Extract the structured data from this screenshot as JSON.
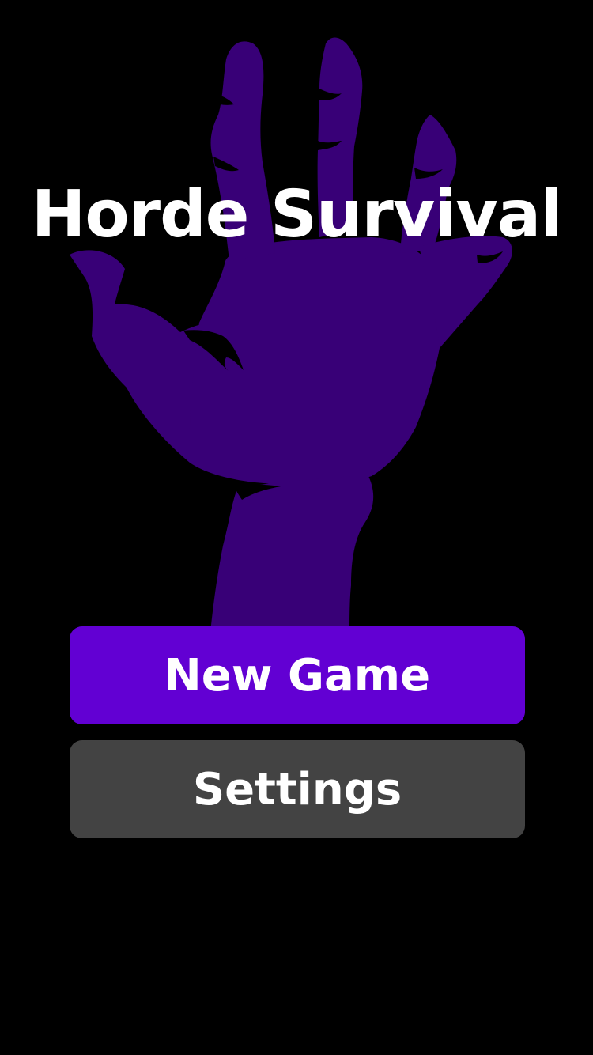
{
  "game": {
    "title": "Horde Survival"
  },
  "menu": {
    "new_game_label": "New Game",
    "settings_label": "Settings"
  },
  "colors": {
    "background": "#000000",
    "hand": "#380077",
    "new_game_button": "#6200d3",
    "settings_button": "#434343",
    "text": "#ffffff"
  },
  "icons": {
    "background_art": "zombie-hand-icon"
  }
}
